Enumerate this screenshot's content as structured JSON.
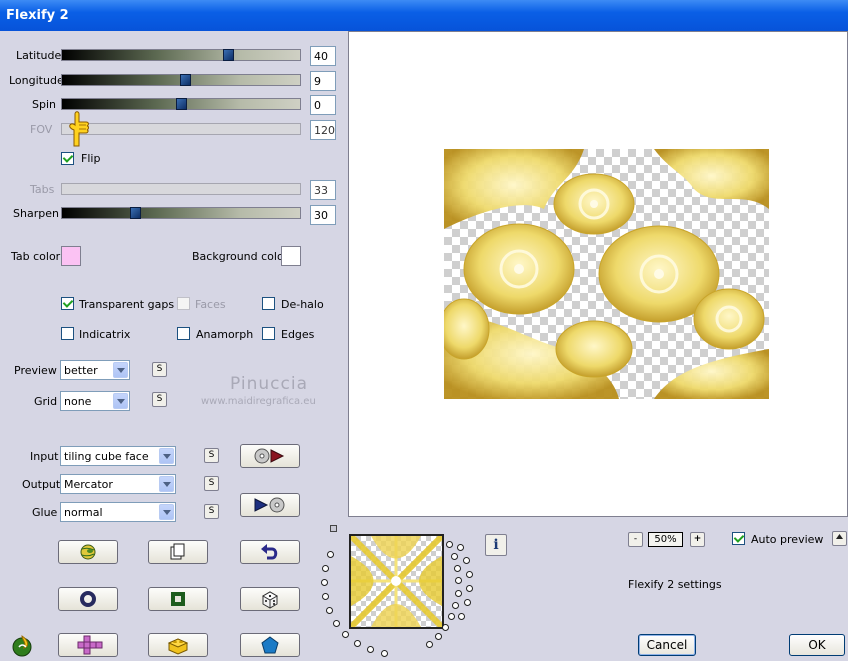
{
  "window": {
    "title": "Flexify 2"
  },
  "sliders": {
    "latitude": {
      "label": "Latitude",
      "value": "40",
      "fraction": 0.71
    },
    "longitude": {
      "label": "Longitude",
      "value": "9",
      "fraction": 0.52
    },
    "spin": {
      "label": "Spin",
      "value": "0",
      "fraction": 0.5
    },
    "fov": {
      "label": "FOV",
      "value": "120"
    },
    "tabs": {
      "label": "Tabs",
      "value": "33"
    },
    "sharpen": {
      "label": "Sharpen",
      "value": "30",
      "fraction": 0.3
    }
  },
  "flip": {
    "label": "Flip",
    "checked": true
  },
  "colors": {
    "tab_color_label": "Tab color",
    "tab_color": "#fbc2f3",
    "background_color_label": "Background color",
    "background_color": "#ffffff"
  },
  "options": {
    "transparent_gaps": "Transparent gaps",
    "faces": "Faces",
    "de_halo": "De-halo",
    "indicatrix": "Indicatrix",
    "anamorph": "Anamorph",
    "edges": "Edges"
  },
  "preview_select": {
    "label": "Preview",
    "value": "better"
  },
  "grid_select": {
    "label": "Grid",
    "value": "none"
  },
  "input_select": {
    "label": "Input",
    "value": "tiling cube face"
  },
  "output_select": {
    "label": "Output",
    "value": "Mercator"
  },
  "glue_select": {
    "label": "Glue",
    "value": "normal"
  },
  "s_label": "S",
  "watermark": {
    "name": "Pinuccia",
    "site": "www.maidiregrafica.eu"
  },
  "zoom": {
    "minus": "-",
    "value": "50%",
    "plus": "+"
  },
  "auto_preview": {
    "label": "Auto preview",
    "checked": true
  },
  "status": "Flexify 2 settings",
  "info": "i",
  "buttons": {
    "cancel": "Cancel",
    "ok": "OK"
  },
  "accent": "#0753d9"
}
